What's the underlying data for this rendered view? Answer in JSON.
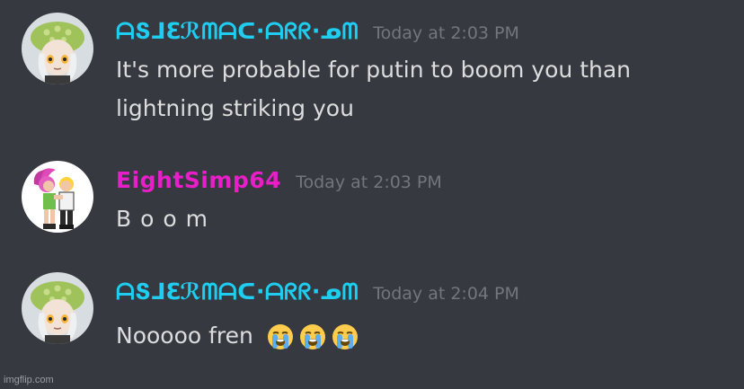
{
  "colors": {
    "background": "#36393f",
    "username_primary": "#1ecdf0",
    "username_secondary": "#e91ec9",
    "timestamp": "#72767d",
    "message_text": "#dcddde"
  },
  "messages": [
    {
      "username": "ᗩՏ⅃ℇℛᗰᗩᑕ·ᗩᖇᖇ·ᓄᗰ",
      "timestamp": "Today at 2:03 PM",
      "lines": [
        "It's more probable for putin to boom you than",
        "lightning striking you"
      ],
      "avatar": "squid-girl-avatar"
    },
    {
      "username": "EightSimp64",
      "timestamp": "Today at 2:03 PM",
      "lines": [
        "B o o m"
      ],
      "avatar": "couple-hug-avatar"
    },
    {
      "username": "ᗩՏ⅃ℇℛᗰᗩᑕ·ᗩᖇᖇ·ᓄᗰ",
      "timestamp": "Today at 2:04 PM",
      "lines": [
        "Nooooo fren"
      ],
      "emojis": [
        "loudly-crying-face-icon",
        "loudly-crying-face-icon",
        "loudly-crying-face-icon"
      ],
      "avatar": "squid-girl-avatar"
    }
  ],
  "watermark": "imgflip.com"
}
